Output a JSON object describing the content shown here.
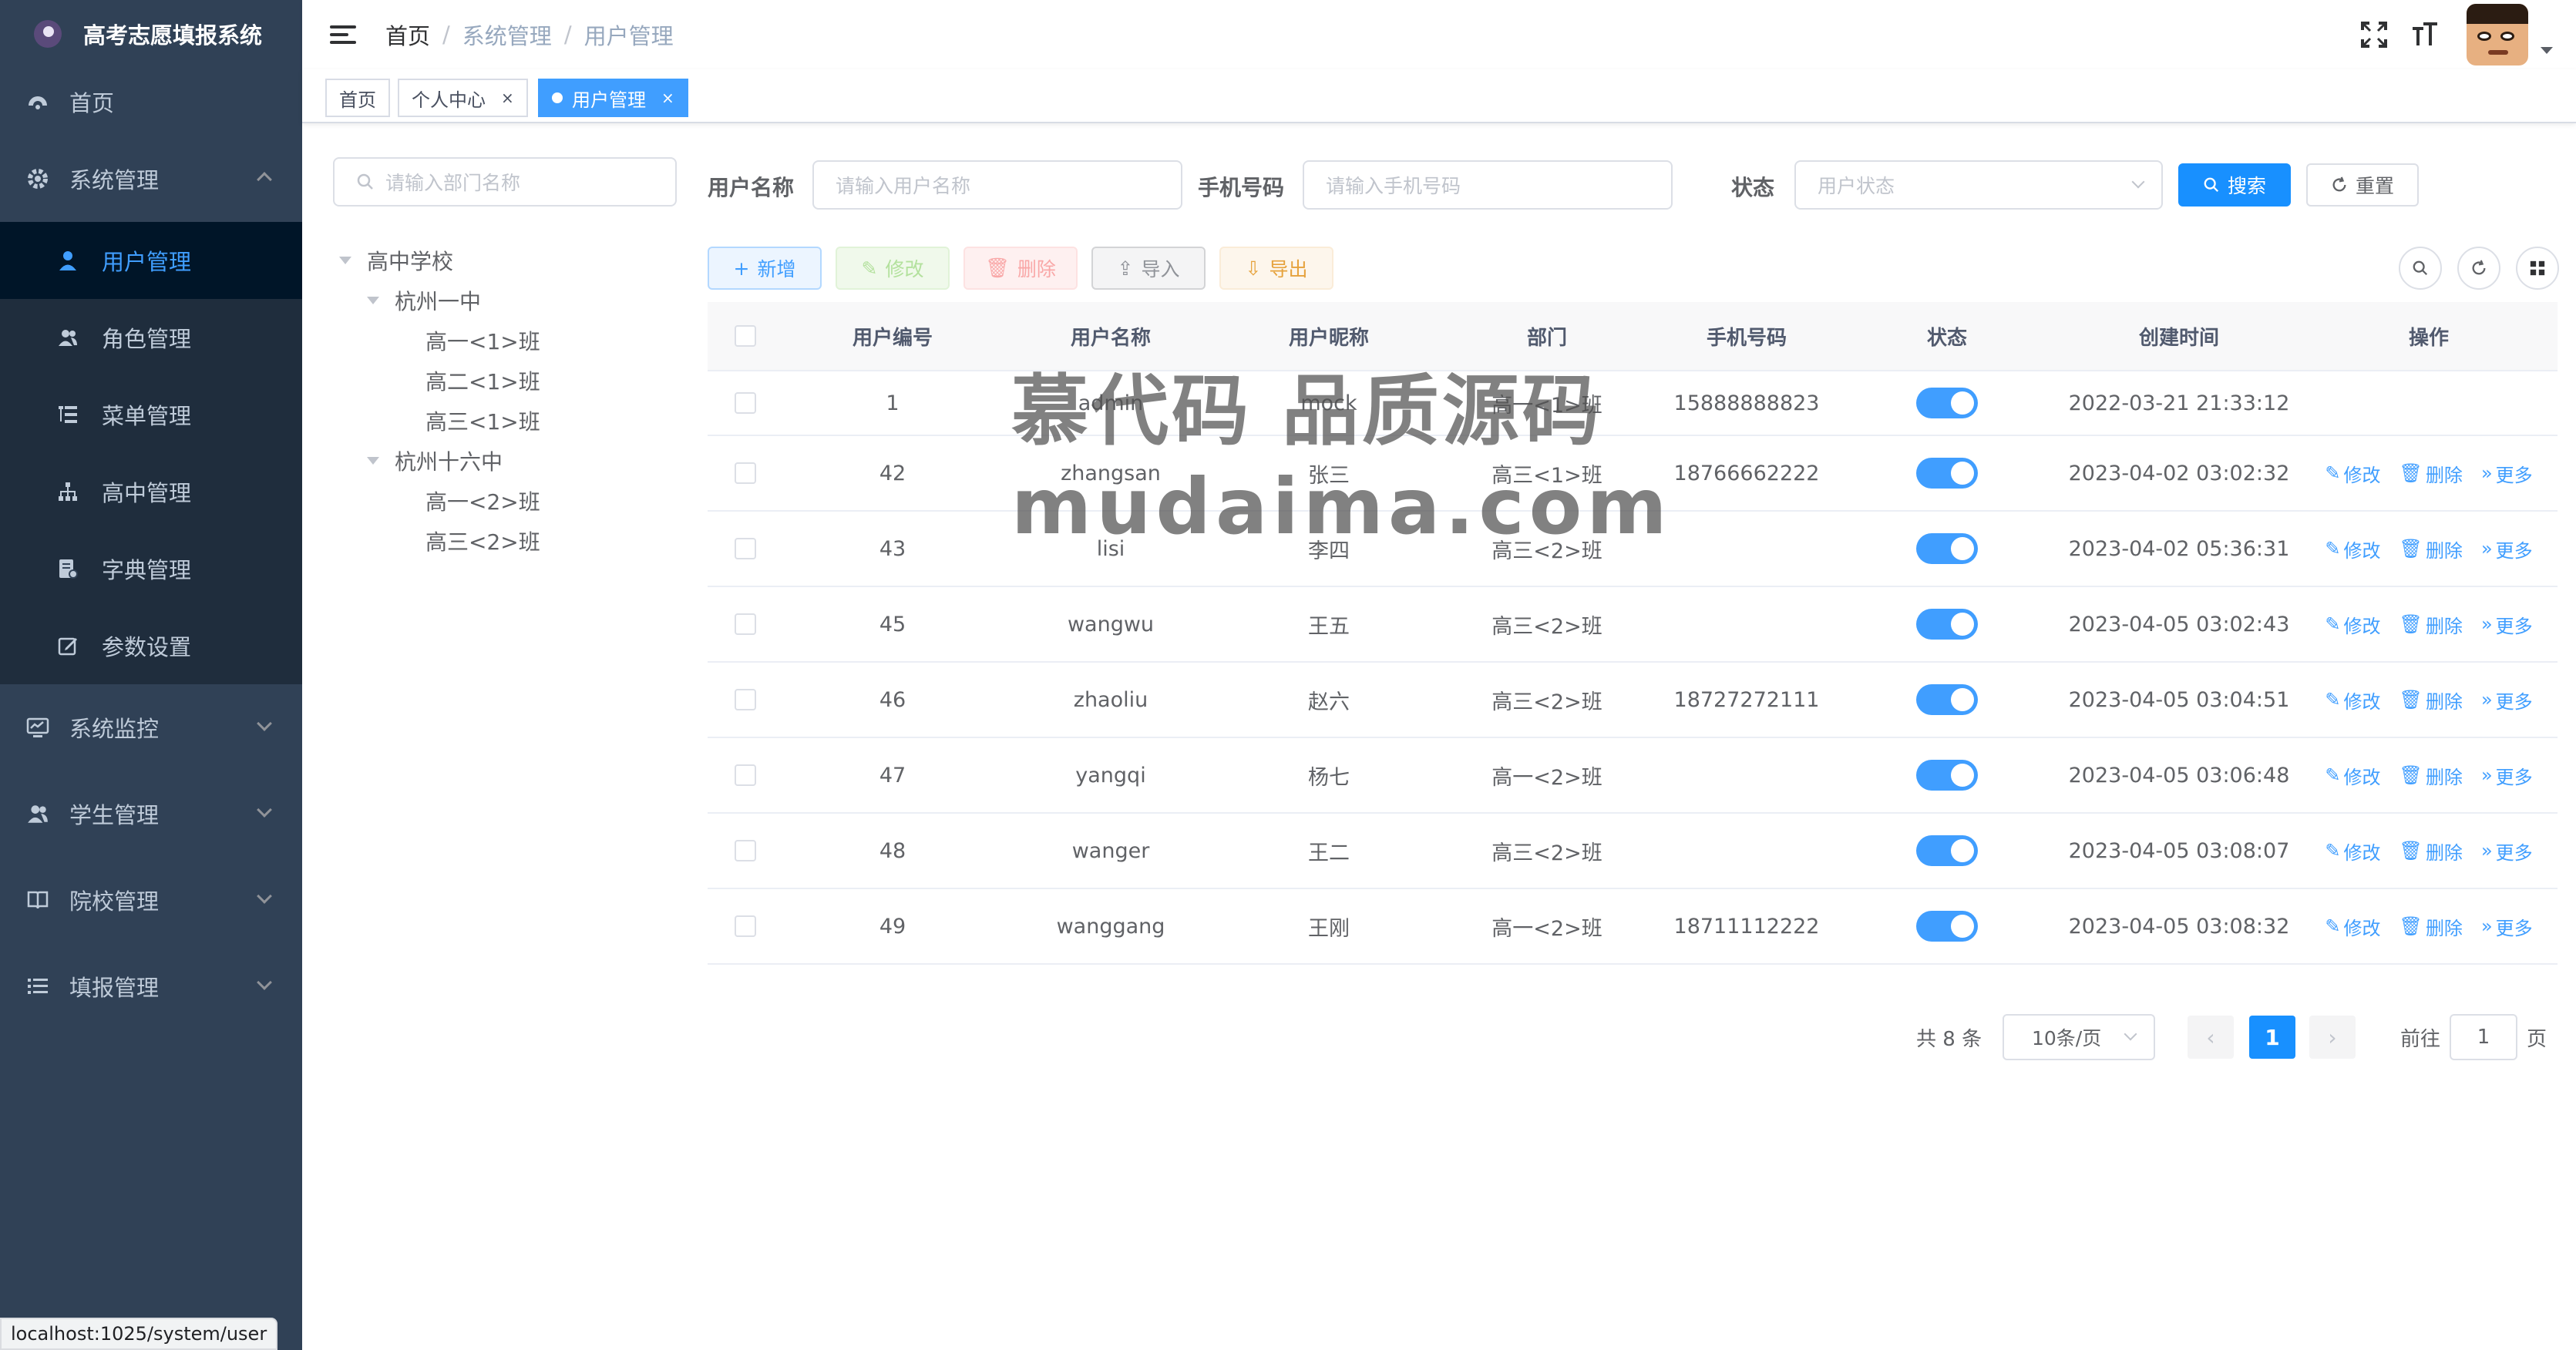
{
  "app": {
    "title": "高考志愿填报系统"
  },
  "sidebar": {
    "home": "首页",
    "system": {
      "label": "系统管理",
      "items": [
        {
          "label": "用户管理",
          "icon": "user-icon",
          "active": true
        },
        {
          "label": "角色管理",
          "icon": "peoples-icon"
        },
        {
          "label": "菜单管理",
          "icon": "tree-table-icon"
        },
        {
          "label": "高中管理",
          "icon": "tree-icon"
        },
        {
          "label": "字典管理",
          "icon": "dict-icon"
        },
        {
          "label": "参数设置",
          "icon": "edit-icon"
        }
      ]
    },
    "groups": [
      {
        "label": "系统监控",
        "icon": "monitor-icon"
      },
      {
        "label": "学生管理",
        "icon": "peoples-icon"
      },
      {
        "label": "院校管理",
        "icon": "book-icon"
      },
      {
        "label": "填报管理",
        "icon": "list-icon"
      }
    ]
  },
  "navbar": {
    "breadcrumb": [
      "首页",
      "系统管理",
      "用户管理"
    ],
    "separator": "/"
  },
  "tags": [
    {
      "label": "首页"
    },
    {
      "label": "个人中心",
      "close": "×"
    },
    {
      "label": "用户管理",
      "close": "×",
      "active": true
    }
  ],
  "tree": {
    "search_placeholder": "请输入部门名称",
    "root": "高中学校",
    "school1": "杭州一中",
    "school1_classes": [
      "高一<1>班",
      "高二<1>班",
      "高三<1>班"
    ],
    "school2": "杭州十六中",
    "school2_classes": [
      "高一<2>班",
      "高三<2>班"
    ]
  },
  "search": {
    "username_label": "用户名称",
    "username_placeholder": "请输入用户名称",
    "phone_label": "手机号码",
    "phone_placeholder": "请输入手机号码",
    "status_label": "状态",
    "status_placeholder": "用户状态",
    "search_btn": "搜索",
    "reset_btn": "重置"
  },
  "toolbar": {
    "add": "新增",
    "edit": "修改",
    "delete": "删除",
    "import": "导入",
    "export": "导出"
  },
  "table": {
    "headers": [
      "用户编号",
      "用户名称",
      "用户昵称",
      "部门",
      "手机号码",
      "状态",
      "创建时间",
      "操作"
    ],
    "op_labels": {
      "edit": "修改",
      "delete": "删除",
      "more": "更多"
    },
    "rows": [
      {
        "id": "1",
        "name": "admin",
        "nick": "mock",
        "dept": "高一<1>班",
        "phone": "15888888823",
        "status": "on",
        "time": "2022-03-21 21:33:12",
        "ops": false
      },
      {
        "id": "42",
        "name": "zhangsan",
        "nick": "张三",
        "dept": "高三<1>班",
        "phone": "18766662222",
        "status": "on",
        "time": "2023-04-02 03:02:32",
        "ops": true
      },
      {
        "id": "43",
        "name": "lisi",
        "nick": "李四",
        "dept": "高三<2>班",
        "phone": "",
        "status": "on",
        "time": "2023-04-02 05:36:31",
        "ops": true
      },
      {
        "id": "45",
        "name": "wangwu",
        "nick": "王五",
        "dept": "高三<2>班",
        "phone": "",
        "status": "on",
        "time": "2023-04-05 03:02:43",
        "ops": true
      },
      {
        "id": "46",
        "name": "zhaoliu",
        "nick": "赵六",
        "dept": "高三<2>班",
        "phone": "18727272111",
        "status": "on",
        "time": "2023-04-05 03:04:51",
        "ops": true
      },
      {
        "id": "47",
        "name": "yangqi",
        "nick": "杨七",
        "dept": "高一<2>班",
        "phone": "",
        "status": "on",
        "time": "2023-04-05 03:06:48",
        "ops": true
      },
      {
        "id": "48",
        "name": "wanger",
        "nick": "王二",
        "dept": "高三<2>班",
        "phone": "",
        "status": "on",
        "time": "2023-04-05 03:08:07",
        "ops": true
      },
      {
        "id": "49",
        "name": "wanggang",
        "nick": "王刚",
        "dept": "高一<2>班",
        "phone": "18711112222",
        "status": "on",
        "time": "2023-04-05 03:08:32",
        "ops": true
      }
    ]
  },
  "pagination": {
    "total": "共 8 条",
    "page_size": "10条/页",
    "current": "1",
    "goto_label": "前往",
    "goto_value": "1",
    "page_unit": "页"
  },
  "watermark": {
    "line1": "慕代码 品质源码",
    "line2": "mudaima.com"
  },
  "status_bar": {
    "url": "localhost:1025/system/user"
  },
  "colors": {
    "primary": "#409eff",
    "sidebar": "#304156",
    "submenu": "#1f2d3d",
    "active_bg": "#001528"
  }
}
